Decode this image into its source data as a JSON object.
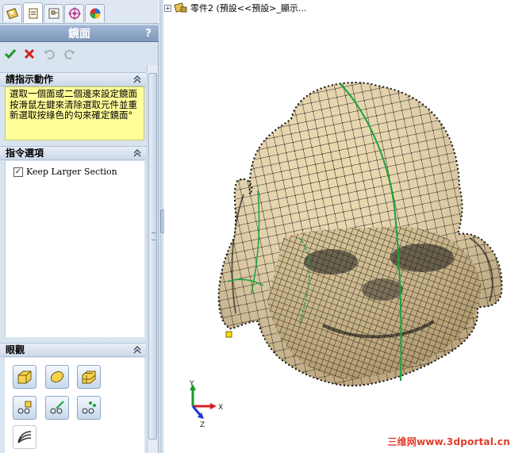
{
  "tabs": [
    {
      "name": "feature-manager-tab",
      "icon": "feature-manager-icon"
    },
    {
      "name": "property-manager-tab",
      "icon": "property-manager-icon"
    },
    {
      "name": "configuration-manager-tab",
      "icon": "configuration-manager-icon"
    },
    {
      "name": "dimxpert-manager-tab",
      "icon": "target-icon"
    },
    {
      "name": "display-manager-tab",
      "icon": "appearance-icon"
    }
  ],
  "property_manager": {
    "title": "鏡面",
    "help_label": "?",
    "actions": [
      "ok-check-icon",
      "cancel-x-icon",
      "undo-icon",
      "redo-icon"
    ]
  },
  "message": {
    "header": "請指示動作",
    "text": "選取一個面或二個邊來設定鏡面按滑鼠左鍵來清除選取元件並重新選取按綠色的勾來確定鏡面°"
  },
  "options": {
    "header": "指令選項",
    "keep_larger_label": "Keep Larger Section",
    "keep_larger_checked": "✓"
  },
  "view": {
    "header": "眼觀",
    "buttons": [
      "shaded-icon",
      "smooth-icon",
      "mesh-icon",
      "vertex-points-icon",
      "edge-points-icon",
      "surface-points-icon",
      "curvature-icon"
    ]
  },
  "viewport": {
    "tree_label": "零件2  (預設<<預設>_顯示...",
    "watermark": "三维网www.3dportal.cn",
    "axis_labels": {
      "x": "X",
      "y": "Y",
      "z": "Z"
    }
  },
  "colors": {
    "mesh_fill": "#e9d7ac",
    "mesh_line": "#1a1a1a",
    "seam_green": "#1aa33a",
    "accent_red": "#e23c2a"
  }
}
